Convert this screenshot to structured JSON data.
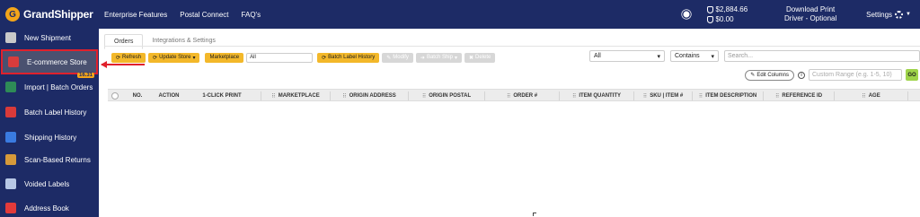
{
  "header": {
    "logo_letter": "G",
    "logo_text": "GrandShipper",
    "nav": [
      "Enterprise Features",
      "Postal Connect",
      "FAQ's"
    ],
    "balance_primary": "$2,884.66",
    "balance_secondary": "$0.00",
    "download_line1": "Download Print",
    "download_line2": "Driver - Optional",
    "settings_label": "Settings",
    "icons": [
      "sun-icon",
      "balance-icon",
      "shield-icon",
      "gear-icon"
    ],
    "background": "#1d2b66"
  },
  "sidebar": {
    "items": [
      {
        "label": "New Shipment",
        "icon": "shipment-icon",
        "color": "#c9c9c9"
      },
      {
        "label": "E-commerce Store",
        "icon": "store-icon",
        "color": "#d83c3c",
        "active": true,
        "badge": "16.31"
      },
      {
        "label": "Import | Batch Orders",
        "icon": "excel-icon",
        "color": "#2e8b57"
      },
      {
        "label": "Batch Label History",
        "icon": "pdf-icon",
        "color": "#d93a3a"
      },
      {
        "label": "Shipping History",
        "icon": "truck-icon",
        "color": "#3a7be0"
      },
      {
        "label": "Scan-Based Returns",
        "icon": "box-icon",
        "color": "#d69a3a"
      },
      {
        "label": "Voided Labels",
        "icon": "void-icon",
        "color": "#b7c8e6"
      },
      {
        "label": "Address Book",
        "icon": "book-icon",
        "color": "#e23a3a"
      }
    ],
    "active_border": "#e0212c"
  },
  "main": {
    "tabs": [
      {
        "label": "Orders",
        "active": true
      },
      {
        "label": "Integrations & Settings",
        "active": false
      }
    ],
    "toolbar": {
      "refresh": "Refresh",
      "update_store": "Update Store",
      "marketplace_label": "Marketplace",
      "marketplace_value": "All",
      "batch_label_history": "Batch Label History",
      "modify": "Modify",
      "batch_ship": "Batch Ship",
      "delete": "Delete"
    },
    "filters": {
      "scope_value": "All",
      "match_value": "Contains",
      "search_placeholder": "Search..."
    },
    "row2": {
      "edit_columns": "Edit Columns",
      "info_symbol": "i",
      "range_placeholder": "Custom Range (e.g. 1-5, 10)",
      "go": "GO"
    },
    "columns": [
      "NO.",
      "ACTION",
      "1-CLICK PRINT",
      "MARKETPLACE",
      "ORIGIN ADDRESS",
      "ORIGIN POSTAL",
      "ORDER #",
      "ITEM QUANTITY",
      "SKU | ITEM #",
      "ITEM DESCRIPTION",
      "REFERENCE ID",
      "AGE"
    ],
    "accent_yellow": "#f3b82a",
    "accent_green": "#9ed34a"
  },
  "annotation": {
    "arrow_color": "#e0212c"
  }
}
